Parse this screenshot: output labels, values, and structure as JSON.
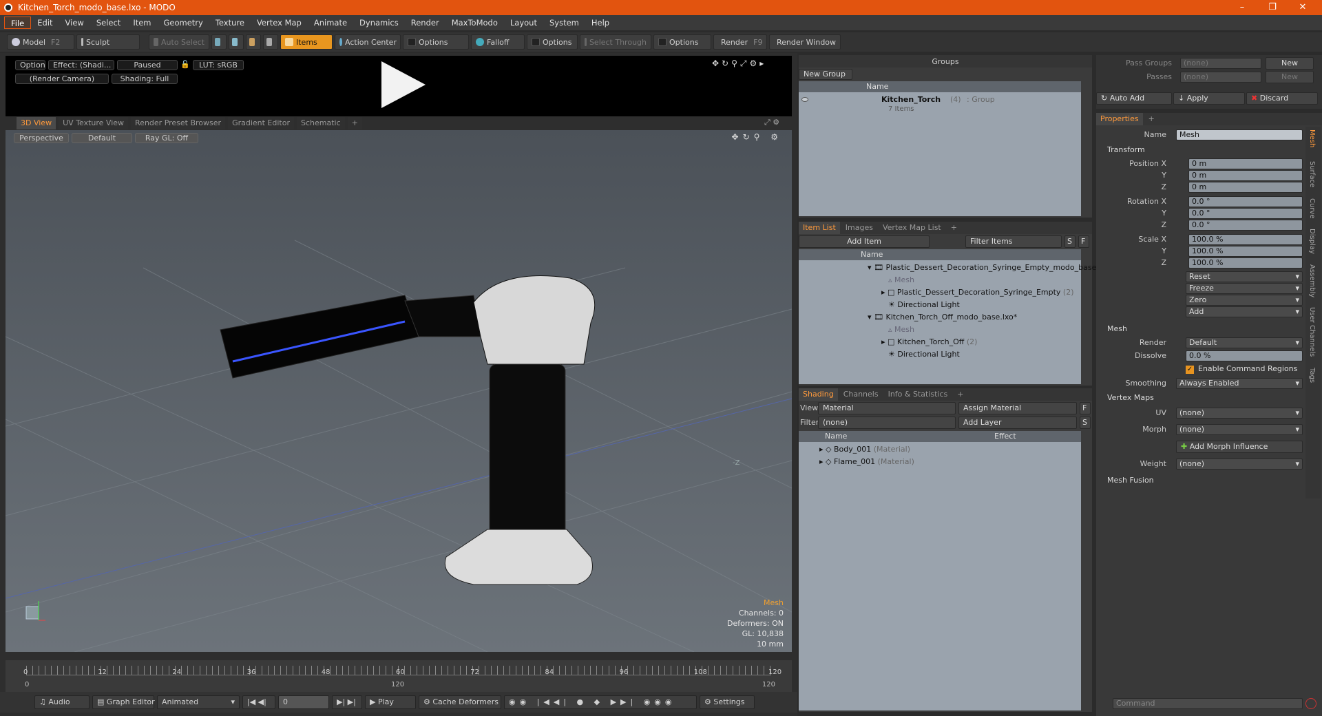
{
  "window": {
    "title": "Kitchen_Torch_modo_base.lxo - MODO"
  },
  "menu": [
    "File",
    "Edit",
    "View",
    "Select",
    "Item",
    "Geometry",
    "Texture",
    "Vertex Map",
    "Animate",
    "Dynamics",
    "Render",
    "MaxToModo",
    "Layout",
    "System",
    "Help"
  ],
  "toolbar": {
    "model": "Model",
    "model_key": "F2",
    "sculpt": "Sculpt",
    "auto_select": "Auto Select",
    "items": "Items",
    "action_center": "Action Center",
    "options1": "Options",
    "falloff": "Falloff",
    "options2": "Options",
    "select_through": "Select Through",
    "options3": "Options",
    "render": "Render",
    "render_key": "F9",
    "render_window": "Render Window"
  },
  "render_preview": {
    "options": "Options",
    "effect": "Effect: (Shadi...",
    "paused": "Paused",
    "lut": "LUT: sRGB",
    "camera": "(Render Camera)",
    "shading": "Shading: Full"
  },
  "viewport_tabs": [
    "3D View",
    "UV Texture View",
    "Render Preset Browser",
    "Gradient Editor",
    "Schematic",
    "+"
  ],
  "viewport": {
    "perspective": "Perspective",
    "default": "Default",
    "raygl": "Ray GL: Off",
    "axis": "-Z",
    "info": {
      "title": "Mesh",
      "channels": "Channels: 0",
      "deformers": "Deformers: ON",
      "gl": "GL: 10,838",
      "size": "10 mm"
    }
  },
  "timeline": {
    "ticks": [
      "0",
      "12",
      "24",
      "36",
      "48",
      "60",
      "72",
      "84",
      "96",
      "108",
      "120"
    ],
    "start": "0",
    "end": "120",
    "end2": "120"
  },
  "bottombar": {
    "audio": "Audio",
    "graph_editor": "Graph Editor",
    "animated": "Animated",
    "frame": "0",
    "play": "Play",
    "cache_deformers": "Cache Deformers",
    "settings": "Settings"
  },
  "groups": {
    "title": "Groups",
    "new_group": "New Group",
    "col_name": "Name",
    "row_name": "Kitchen_Torch",
    "row_count": "(4)",
    "row_type": ": Group",
    "row_items": "7 Items"
  },
  "itemlist": {
    "tabs": [
      "Item List",
      "Images",
      "Vertex Map List",
      "+"
    ],
    "add_item": "Add Item",
    "filter": "Filter Items",
    "s": "S",
    "f": "F",
    "col_name": "Name",
    "rows": [
      {
        "label": "Plastic_Dessert_Decoration_Syringe_Empty_modo_base.lxo*",
        "note": ""
      },
      {
        "label": "Mesh",
        "note": ""
      },
      {
        "label": "Plastic_Dessert_Decoration_Syringe_Empty",
        "note": "(2)"
      },
      {
        "label": "Directional Light",
        "note": ""
      },
      {
        "label": "Kitchen_Torch_Off_modo_base.lxo*",
        "note": ""
      },
      {
        "label": "Mesh",
        "note": ""
      },
      {
        "label": "Kitchen_Torch_Off",
        "note": "(2)"
      },
      {
        "label": "Directional Light",
        "note": ""
      }
    ]
  },
  "shading": {
    "tabs": [
      "Shading",
      "Channels",
      "Info & Statistics",
      "+"
    ],
    "view_label": "View",
    "view_value": "Material",
    "assign": "Assign Material",
    "f": "F",
    "filter_label": "Filter",
    "filter_value": "(none)",
    "add_layer": "Add Layer",
    "s": "S",
    "col_name": "Name",
    "col_effect": "Effect",
    "rows": [
      {
        "label": "Body_001",
        "note": "(Material)"
      },
      {
        "label": "Flame_001",
        "note": "(Material)"
      }
    ]
  },
  "passes": {
    "pass_groups": "Pass Groups",
    "passes": "Passes",
    "none1": "(none)",
    "none2": "(none)",
    "new1": "New",
    "new2": "New",
    "auto_add": "Auto Add",
    "apply": "Apply",
    "discard": "Discard"
  },
  "properties": {
    "tab": "Properties",
    "plus": "+",
    "name_label": "Name",
    "name_value": "Mesh",
    "transform": "Transform",
    "pos_label": "Position X",
    "y": "Y",
    "z": "Z",
    "pos_x": "0 m",
    "pos_y": "0 m",
    "pos_z": "0 m",
    "rot_label": "Rotation X",
    "rot_x": "0.0 °",
    "rot_y": "0.0 °",
    "rot_z": "0.0 °",
    "scale_label": "Scale X",
    "scale_x": "100.0 %",
    "scale_y": "100.0 %",
    "scale_z": "100.0 %",
    "reset": "Reset",
    "freeze": "Freeze",
    "zero": "Zero",
    "add": "Add",
    "mesh": "Mesh",
    "render_label": "Render",
    "render_value": "Default",
    "dissolve_label": "Dissolve",
    "dissolve_value": "0.0 %",
    "enable_cmd": "Enable Command Regions",
    "smoothing_label": "Smoothing",
    "smoothing_value": "Always Enabled",
    "vertex_maps": "Vertex Maps",
    "uv_label": "UV",
    "uv_value": "(none)",
    "morph_label": "Morph",
    "morph_value": "(none)",
    "add_morph": "Add Morph Influence",
    "weight_label": "Weight",
    "weight_value": "(none)",
    "mesh_fusion": "Mesh Fusion",
    "side_tabs": [
      "Mesh",
      "Surface",
      "Curve",
      "Display",
      "Assembly",
      "User Channels",
      "Tags"
    ],
    "command": "Command"
  }
}
